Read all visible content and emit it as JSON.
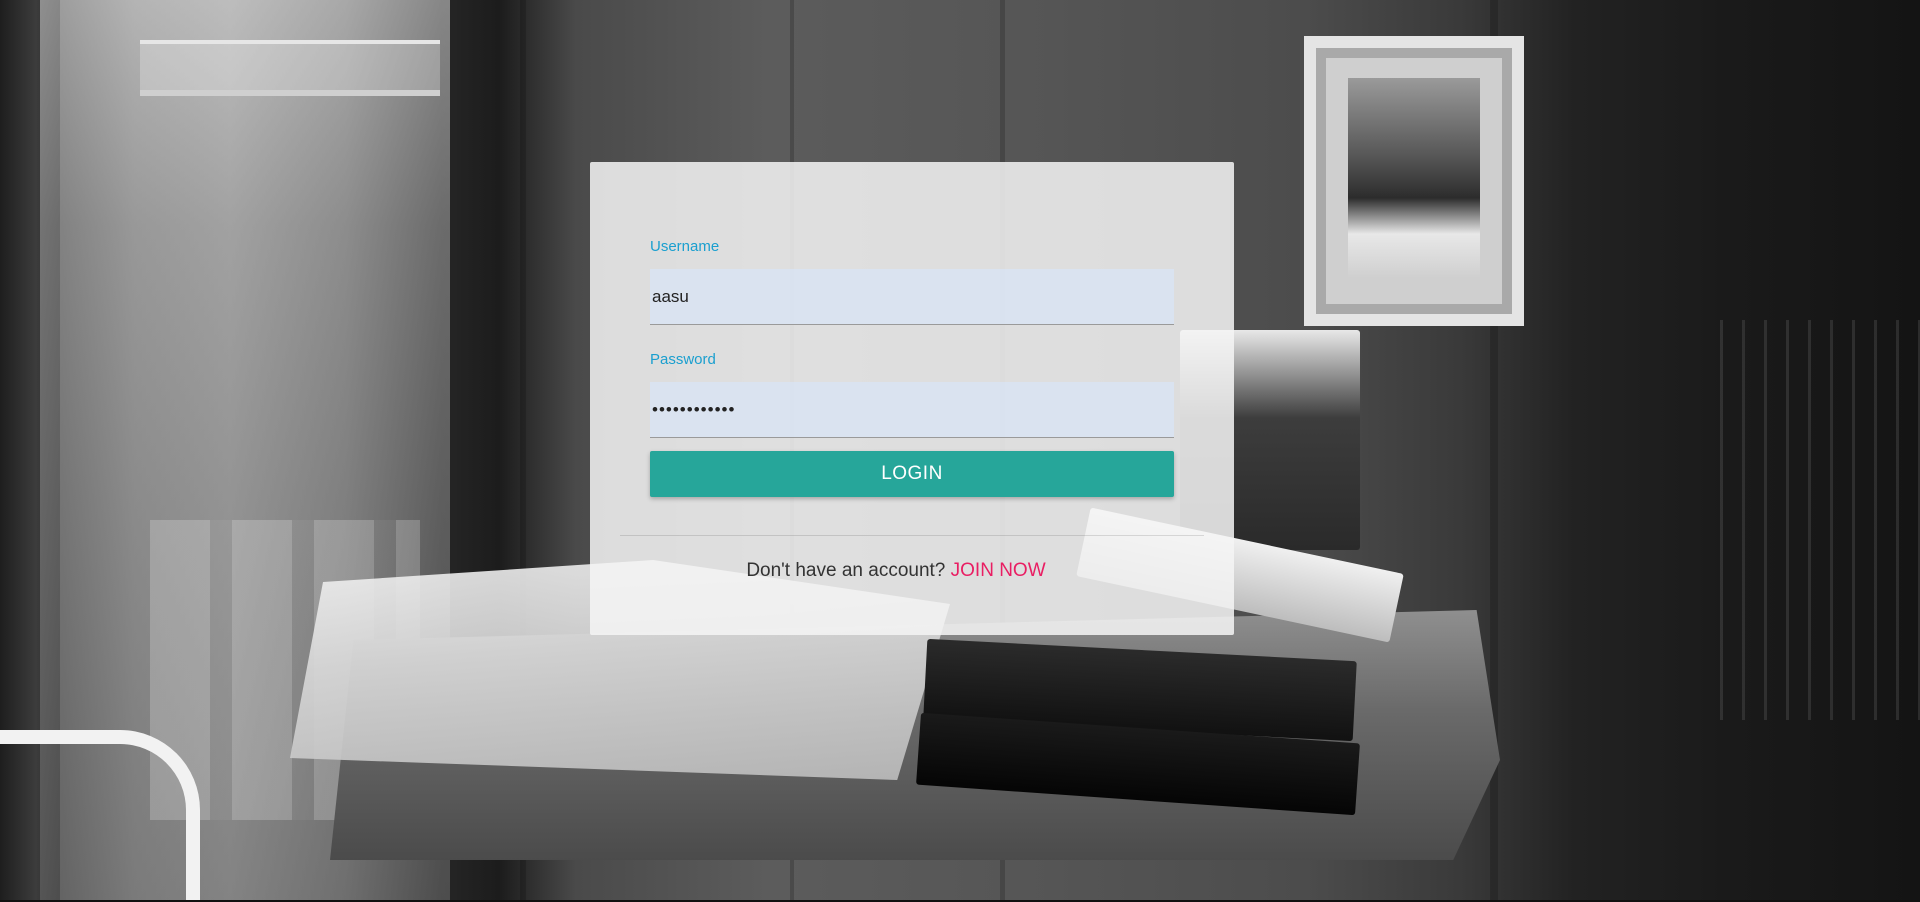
{
  "login_form": {
    "username_label": "Username",
    "username_value": "aasu",
    "password_label": "Password",
    "password_value": "••••••••••••",
    "login_button": "LOGIN",
    "signup_prompt": "Don't have an account?",
    "join_link": "JOIN NOW"
  },
  "colors": {
    "label_blue": "#1a9fcf",
    "button_teal": "#26a69a",
    "link_pink": "#e91e63",
    "input_fill": "#d8e4f6"
  }
}
